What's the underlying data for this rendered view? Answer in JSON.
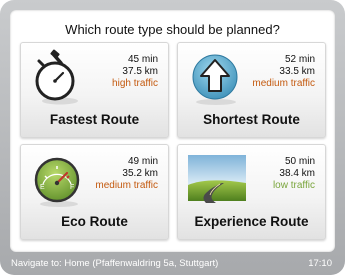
{
  "title": "Which route type should be planned?",
  "routes": [
    {
      "name": "Fastest Route",
      "time": "45 min",
      "distance": "37.5 km",
      "traffic": "high traffic",
      "icon": "stopwatch-icon"
    },
    {
      "name": "Shortest Route",
      "time": "52 min",
      "distance": "33.5 km",
      "traffic": "medium traffic",
      "icon": "up-arrow-icon"
    },
    {
      "name": "Eco Route",
      "time": "49 min",
      "distance": "35.2 km",
      "traffic": "medium traffic",
      "icon": "fuel-gauge-icon"
    },
    {
      "name": "Experience Route",
      "time": "50 min",
      "distance": "38.4 km",
      "traffic": "low traffic",
      "icon": "scenic-road-icon"
    }
  ],
  "status": {
    "destination": "Navigate to: Home (Pfaffenwaldring 5a, Stuttgart)",
    "time": "17:10"
  },
  "colors": {
    "high_traffic": "#c45a0f",
    "medium_traffic": "#c45a0f",
    "low_traffic": "#7aa53c"
  }
}
